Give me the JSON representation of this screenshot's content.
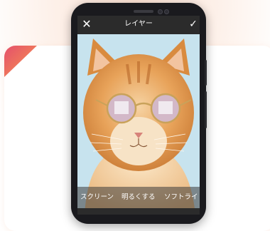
{
  "editor": {
    "title": "レイヤー",
    "close_icon": "close-icon",
    "confirm_icon": "check-icon"
  },
  "blend_modes": {
    "items": [
      "スクリーン",
      "明るくする",
      "ソフトライト"
    ]
  },
  "photo": {
    "subject": "orange tabby cat wearing round sunglasses"
  },
  "colors": {
    "accent": "#e4506b",
    "toolbar": "#2b2b2b",
    "sky": "#c9e4ee"
  }
}
